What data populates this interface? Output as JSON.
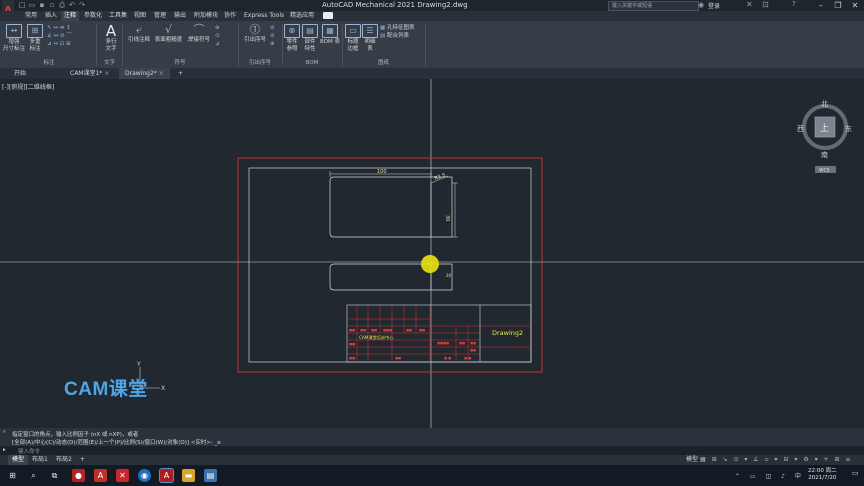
{
  "titlebar": {
    "app_title": "AutoCAD Mechanical 2021    Drawing2.dwg",
    "search_placeholder": "键入关键字或短语",
    "login": "登录",
    "help": "?"
  },
  "menu_tabs": [
    "常用",
    "插入",
    "注释",
    "参数化",
    "工具集",
    "视图",
    "管理",
    "输出",
    "附加模块",
    "协作",
    "Express Tools",
    "精选应用"
  ],
  "ribbon": {
    "buttons": {
      "smart_dim": "增强\n尺寸标注",
      "multi_dim": "多重\n标注",
      "mtext": "多行\n文字",
      "leader_note": "引线注释",
      "surface_texture": "表面粗糙度",
      "weld": "焊接符号",
      "balloon": "引出序号",
      "parts_ref": "零件\n参照",
      "parts_prop": "部件\n特性",
      "bom": "BOM 表",
      "title_border": "标题\n边框",
      "parts_list": "明细\n表",
      "hole_chart": "孔特征图表",
      "fits_list": "配合列表"
    },
    "groups": [
      "标注",
      "文字",
      "符号",
      "引出序号",
      "BOM",
      "图纸"
    ]
  },
  "doc_tabs": [
    "开始",
    "CAM课堂1*",
    "Drawing2*"
  ],
  "viewport_label": "[-][俯视][二维线框]",
  "viewcube": {
    "north": "北",
    "south": "南",
    "east": "东",
    "west": "西",
    "top": "上",
    "wcs": "WCS"
  },
  "drawing": {
    "dim_width": "100",
    "dim_angle": "R2.5",
    "dim_height": "30",
    "dim_small": "20",
    "title_block_name": "Drawing2",
    "title_block_company": "CAM课堂培训中心"
  },
  "watermark": "CAM课堂",
  "ucs": {
    "y": "Y",
    "x": "X"
  },
  "command": {
    "line1": "指定窗口的角点，输入比例因子 (nX 或 nXP)，或者",
    "line2": "[全部(A)/中心(C)/动态(D)/范围(E)/上一个(P)/比例(S)/窗口(W)/对象(O)] <实时>: _e",
    "input_placeholder": "键入命令"
  },
  "layout_tabs": [
    "模型",
    "布局1",
    "布局2",
    "+"
  ],
  "statusbar": {
    "mode": "模型"
  },
  "taskbar": {
    "time": "22:00 周二",
    "date": "2021/7/20"
  }
}
